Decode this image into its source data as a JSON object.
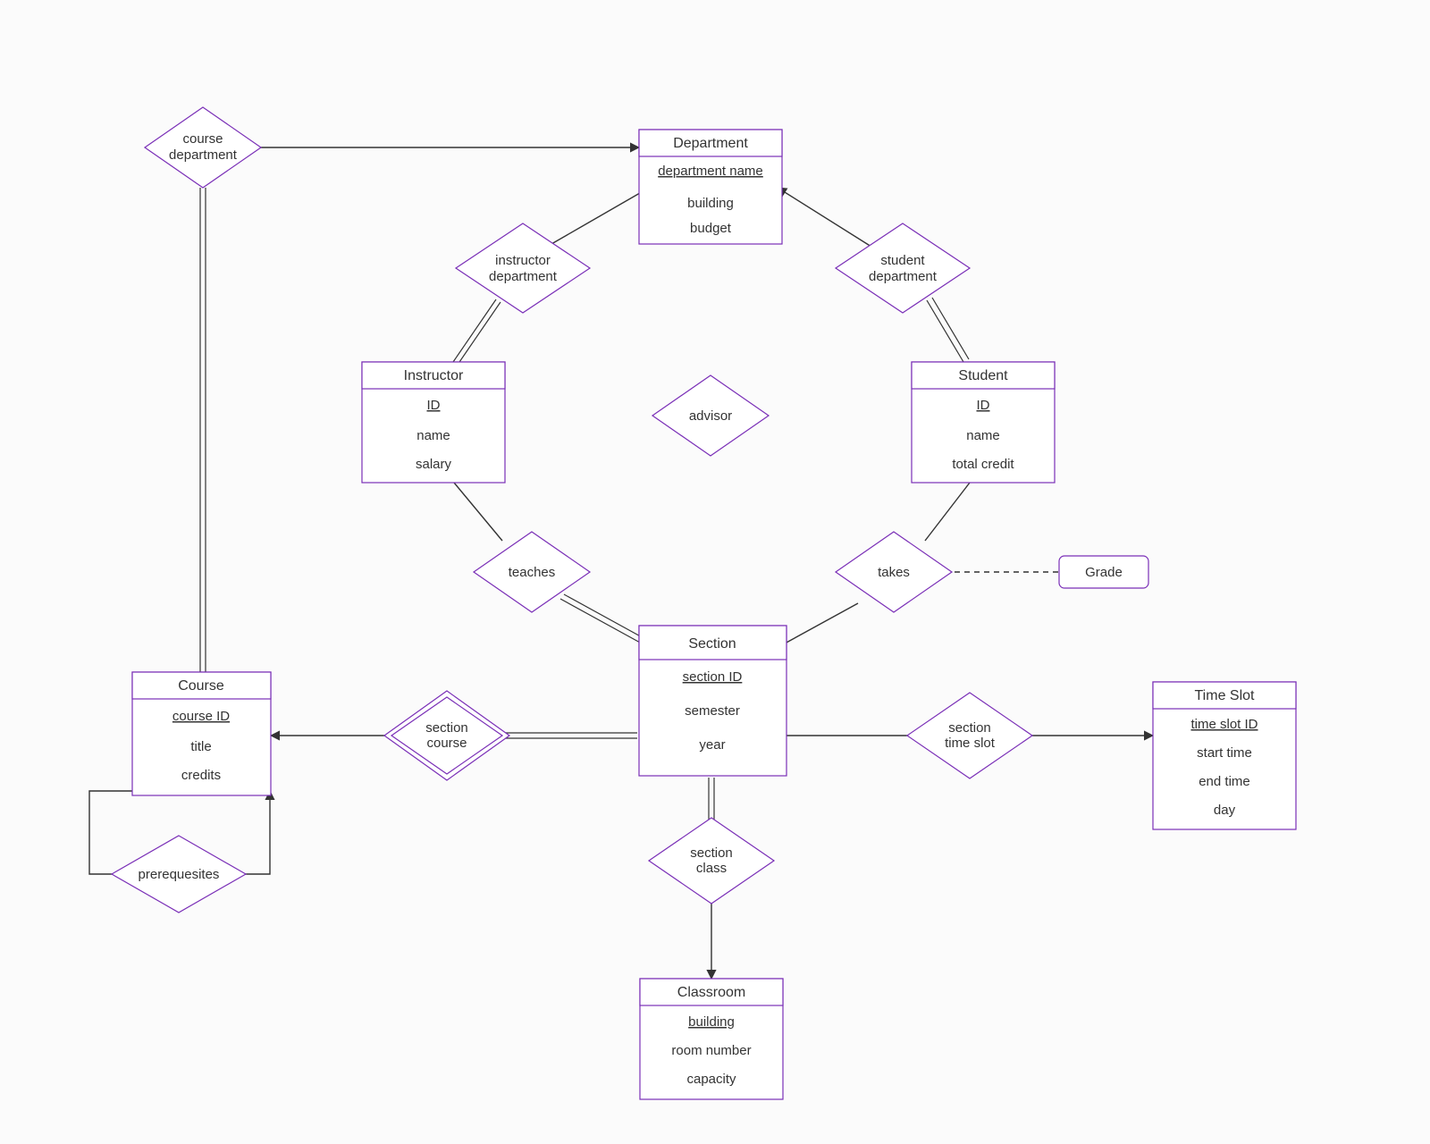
{
  "entities": {
    "department": {
      "title": "Department",
      "key": "department name",
      "attrs": [
        "building",
        "budget"
      ]
    },
    "instructor": {
      "title": "Instructor",
      "key": "ID",
      "attrs": [
        "name",
        "salary"
      ]
    },
    "student": {
      "title": "Student",
      "key": "ID",
      "attrs": [
        "name",
        "total credit"
      ]
    },
    "section": {
      "title": "Section",
      "key": "section ID",
      "attrs": [
        "semester",
        "year"
      ]
    },
    "course": {
      "title": "Course",
      "key": "course ID",
      "attrs": [
        "title",
        "credits"
      ]
    },
    "classroom": {
      "title": "Classroom",
      "key": "building",
      "attrs": [
        "room number",
        "capacity"
      ]
    },
    "timeslot": {
      "title": "Time Slot",
      "key": "time slot ID",
      "attrs": [
        "start time",
        "end time",
        "day"
      ]
    }
  },
  "relationships": {
    "course_department": {
      "l1": "course",
      "l2": "department"
    },
    "instructor_department": {
      "l1": "instructor",
      "l2": "department"
    },
    "student_department": {
      "l1": "student",
      "l2": "department"
    },
    "advisor": {
      "l1": "advisor"
    },
    "teaches": {
      "l1": "teaches"
    },
    "takes": {
      "l1": "takes"
    },
    "section_course": {
      "l1": "section",
      "l2": "course"
    },
    "section_class": {
      "l1": "section",
      "l2": "class"
    },
    "section_time_slot": {
      "l1": "section",
      "l2": "time slot"
    },
    "prerequisites": {
      "l1": "prerequesites"
    }
  },
  "extras": {
    "grade": "Grade"
  }
}
